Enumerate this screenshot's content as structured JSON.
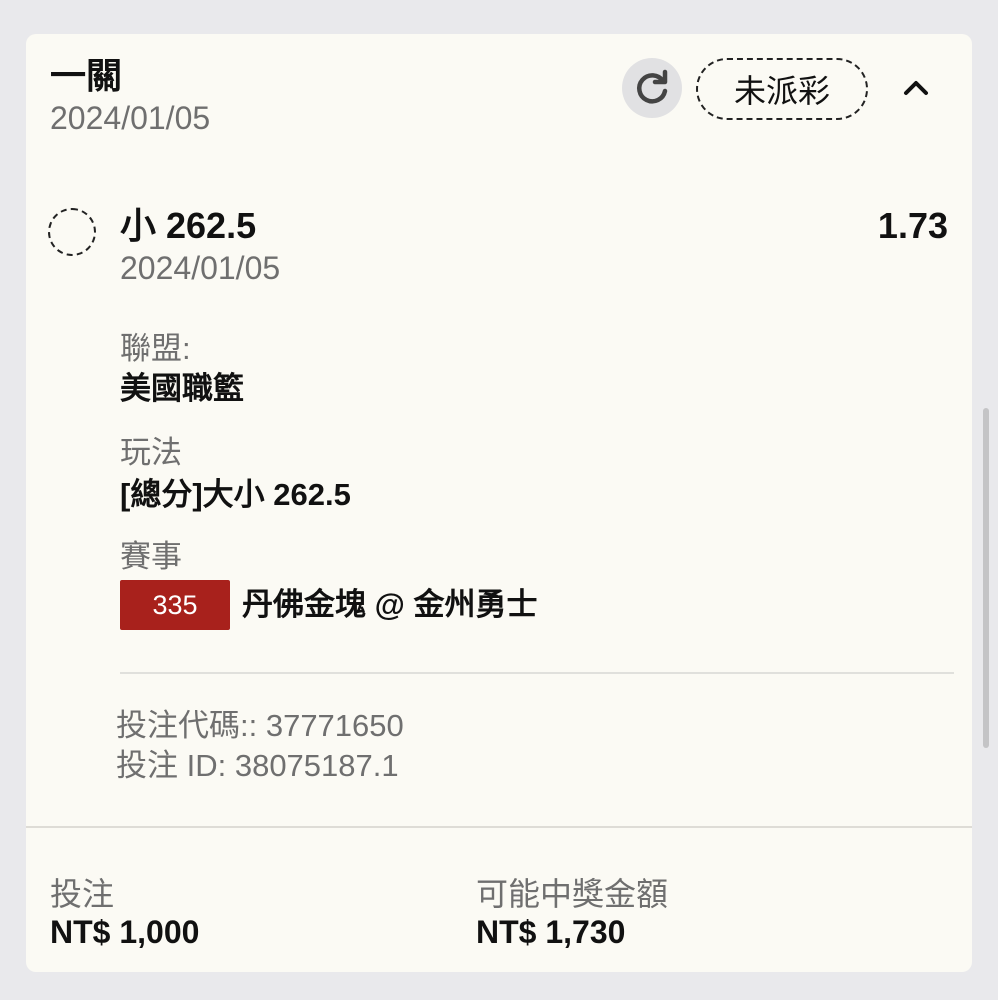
{
  "header": {
    "title": "一關",
    "date": "2024/01/05",
    "refresh_icon": "refresh-icon",
    "status": "未派彩",
    "collapse_icon": "chevron-up-icon"
  },
  "selection": {
    "name": "小 262.5",
    "date": "2024/01/05",
    "odds": "1.73"
  },
  "details": {
    "league_label": "聯盟:",
    "league_value": "美國職籃",
    "bet_type_label": "玩法",
    "bet_type_value": "[總分]大小 262.5",
    "event_label": "賽事",
    "event_number": "335",
    "event_name": "丹佛金塊 @ 金州勇士"
  },
  "bet_info": {
    "code": "投注代碼:: 37771650",
    "id": "投注 ID: 38075187.1"
  },
  "footer": {
    "stake_label": "投注",
    "stake_value": "NT$ 1,000",
    "payout_label": "可能中獎金額",
    "payout_value": "NT$ 1,730"
  },
  "colors": {
    "accent_badge": "#a8211c",
    "card_bg": "#fbfaf4",
    "page_bg": "#e9e9ec",
    "muted_text": "#6f6f6f"
  }
}
